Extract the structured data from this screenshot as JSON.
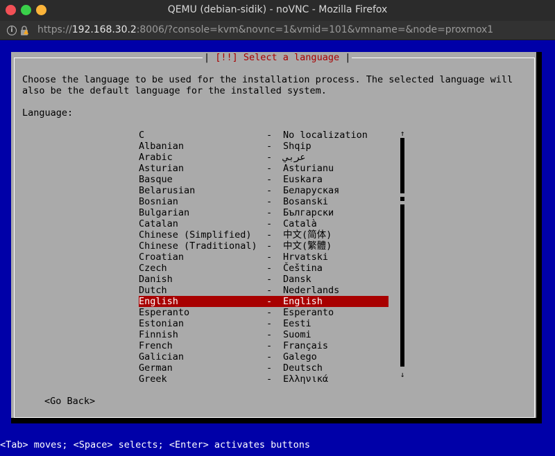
{
  "window": {
    "title": "QEMU (debian-sidik) - noVNC - Mozilla Firefox"
  },
  "urlbar": {
    "url_prefix": "https://",
    "url_host": "192.168.30.2",
    "url_rest": ":8006/?console=kvm&novnc=1&vmid=101&vmname=&node=proxmox1"
  },
  "dialog": {
    "title_left": "[!!] Select a language",
    "description": "Choose the language to be used for the installation process. The selected language will\nalso be the default language for the installed system.",
    "field_label": "Language:",
    "go_back": "<Go Back>"
  },
  "languages": [
    {
      "name": "C",
      "native": "No localization"
    },
    {
      "name": "Albanian",
      "native": "Shqip"
    },
    {
      "name": "Arabic",
      "native": "عربي"
    },
    {
      "name": "Asturian",
      "native": "Asturianu"
    },
    {
      "name": "Basque",
      "native": "Euskara"
    },
    {
      "name": "Belarusian",
      "native": "Беларуская"
    },
    {
      "name": "Bosnian",
      "native": "Bosanski"
    },
    {
      "name": "Bulgarian",
      "native": "Български"
    },
    {
      "name": "Catalan",
      "native": "Català"
    },
    {
      "name": "Chinese (Simplified)",
      "native": "中文(简体)"
    },
    {
      "name": "Chinese (Traditional)",
      "native": "中文(繁體)"
    },
    {
      "name": "Croatian",
      "native": "Hrvatski"
    },
    {
      "name": "Czech",
      "native": "Čeština"
    },
    {
      "name": "Danish",
      "native": "Dansk"
    },
    {
      "name": "Dutch",
      "native": "Nederlands"
    },
    {
      "name": "English",
      "native": "English",
      "selected": true
    },
    {
      "name": "Esperanto",
      "native": "Esperanto"
    },
    {
      "name": "Estonian",
      "native": "Eesti"
    },
    {
      "name": "Finnish",
      "native": "Suomi"
    },
    {
      "name": "French",
      "native": "Français"
    },
    {
      "name": "Galician",
      "native": "Galego"
    },
    {
      "name": "German",
      "native": "Deutsch"
    },
    {
      "name": "Greek",
      "native": "Ελληνικά"
    }
  ],
  "separator": "-",
  "status": {
    "help_line": "<Tab> moves; <Space> selects; <Enter> activates buttons"
  },
  "colors": {
    "screen_blue": "#0000a8",
    "dialog_gray": "#aaaaaa",
    "highlight_red": "#a80000"
  },
  "icons": {
    "scroll_up": "↑",
    "scroll_down": "↓",
    "handle": "▶",
    "info": "i"
  }
}
